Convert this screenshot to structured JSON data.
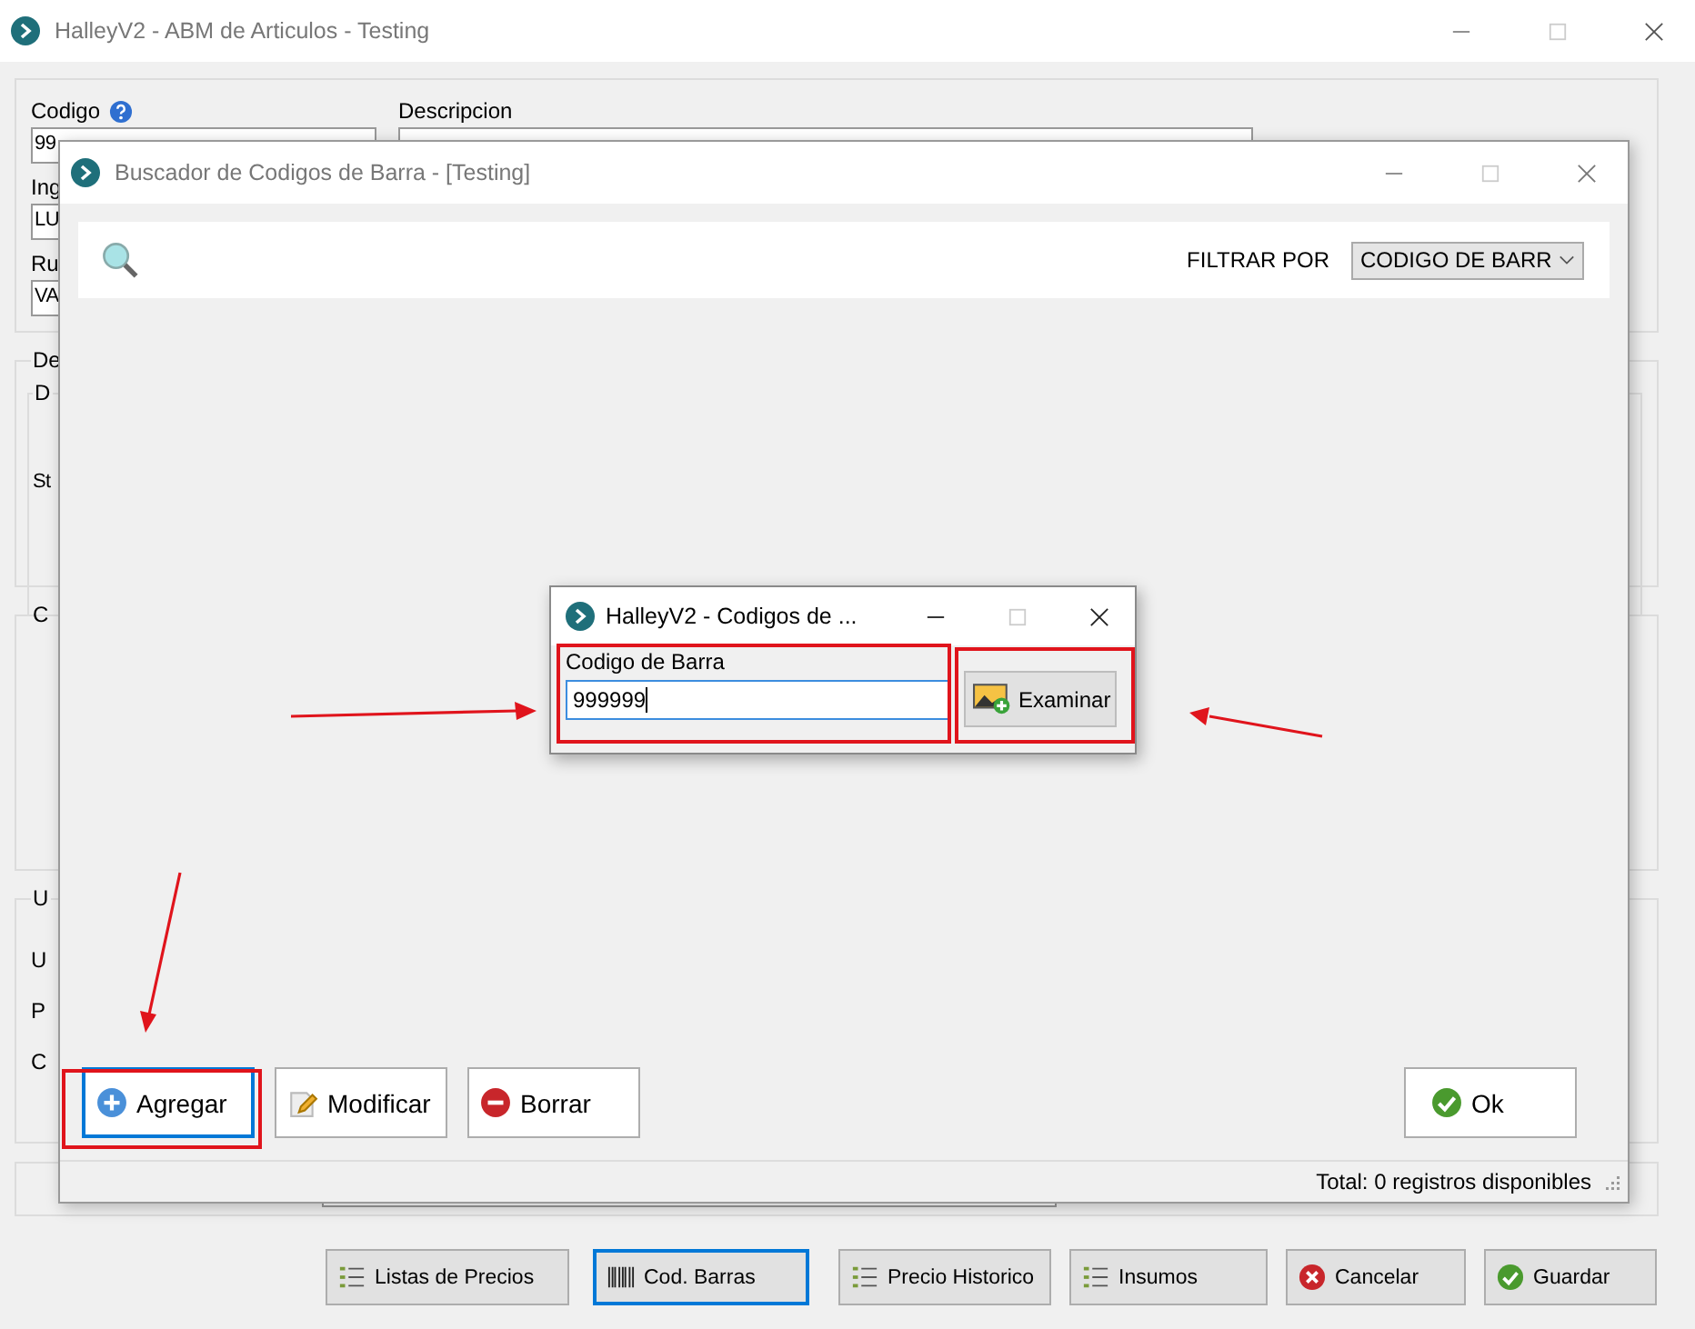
{
  "main_window": {
    "title": "HalleyV2 - ABM de Articulos - Testing",
    "fields": [
      {
        "label": "Codigo",
        "value": "99"
      },
      {
        "label": "Ing",
        "value": "LU"
      },
      {
        "label": "Ru",
        "value": "VA"
      }
    ],
    "description_label": "Descripcion",
    "sections": [
      {
        "legend": "De",
        "inner_legend": "D",
        "labels": [
          "St"
        ]
      },
      {
        "legend": "C"
      },
      {
        "legend": "U",
        "labels": [
          "U",
          "P",
          "C"
        ]
      }
    ],
    "buttons": [
      {
        "label": "Listas de Precios",
        "focused": false
      },
      {
        "label": "Cod. Barras",
        "focused": true
      },
      {
        "label": "Precio Historico",
        "focused": false
      },
      {
        "label": "Insumos",
        "focused": false
      },
      {
        "label": "Cancelar",
        "focused": false
      },
      {
        "label": "Guardar",
        "focused": false
      }
    ]
  },
  "finder_window": {
    "title": "Buscador de Codigos de Barra - [Testing]",
    "filter_label": "FILTRAR POR",
    "filter_value": "CODIGO DE BARR",
    "buttons": [
      {
        "label": "Agregar",
        "focused": true
      },
      {
        "label": "Modificar",
        "focused": false
      },
      {
        "label": "Borrar",
        "focused": false
      }
    ],
    "ok_button": "Ok",
    "status": "Total: 0 registros disponibles"
  },
  "barcode_dialog": {
    "title": "HalleyV2 - Codigos de ...",
    "field_label": "Codigo de Barra",
    "value": "999999",
    "browse_button": "Examinar"
  }
}
